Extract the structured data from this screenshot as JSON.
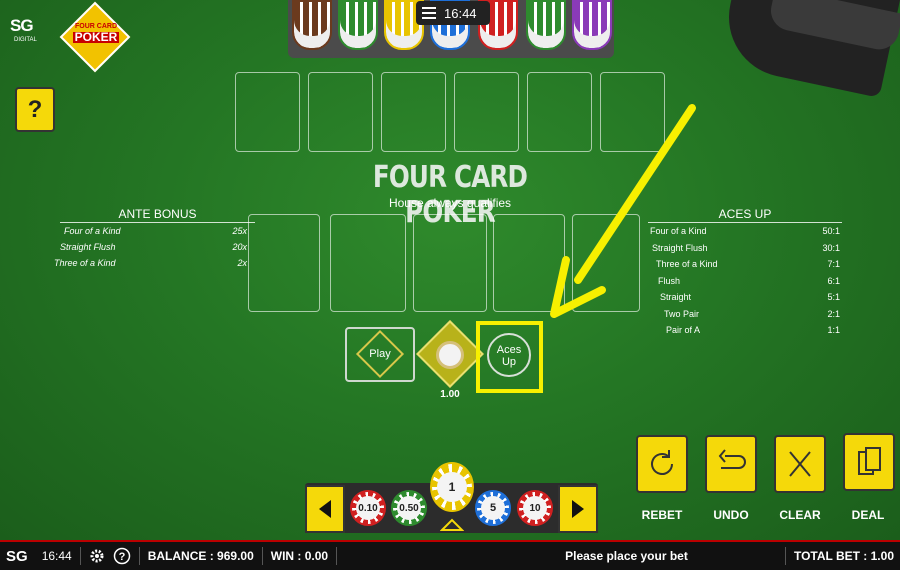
{
  "brand": {
    "sg_logo": "SG",
    "sg_sub": "DIGITAL",
    "game_logo_top": "FOUR CARD",
    "game_logo_bottom": "POKER"
  },
  "help": {
    "label": "?"
  },
  "header": {
    "time": "16:44"
  },
  "rack_chips": [
    "#6b3a1e",
    "#2e8b2e",
    "#e8c400",
    "#1e6fd8",
    "#d02020",
    "#2e8b2e",
    "#8a3ab8"
  ],
  "table": {
    "title": "FOUR CARD POKER",
    "subtitle": "House always qualifies"
  },
  "ante_bonus": {
    "header": "ANTE BONUS",
    "rows": [
      {
        "hand": "Four of a Kind",
        "payout": "25x"
      },
      {
        "hand": "Straight Flush",
        "payout": "20x"
      },
      {
        "hand": "Three of a Kind",
        "payout": "2x"
      }
    ]
  },
  "aces_up": {
    "header": "ACES UP",
    "rows": [
      {
        "hand": "Four of a Kind",
        "payout": "50:1"
      },
      {
        "hand": "Straight Flush",
        "payout": "30:1"
      },
      {
        "hand": "Three of a Kind",
        "payout": "7:1"
      },
      {
        "hand": "Flush",
        "payout": "6:1"
      },
      {
        "hand": "Straight",
        "payout": "5:1"
      },
      {
        "hand": "Two Pair",
        "payout": "2:1"
      },
      {
        "hand": "Pair of A",
        "payout": "1:1"
      }
    ]
  },
  "bets": {
    "play_label": "Play",
    "ante_amount": "1.00",
    "aces_up_label_1": "Aces",
    "aces_up_label_2": "Up"
  },
  "actions": {
    "rebet": "REBET",
    "undo": "UNDO",
    "clear": "CLEAR",
    "deal": "DEAL"
  },
  "chips": {
    "values": [
      "0.10",
      "0.50",
      "1",
      "5",
      "10"
    ],
    "colors": [
      "#d02020",
      "#2e8b2e",
      "#e8c400",
      "#1e6fd8",
      "#d02020"
    ],
    "selected": "1"
  },
  "status_bar": {
    "logo": "SG",
    "time": "16:44",
    "balance": "BALANCE : 969.00",
    "win": "WIN : 0.00",
    "message": "Please place your bet",
    "total_bet": "TOTAL BET : 1.00"
  },
  "accent": {
    "yellow": "#f5d90a",
    "highlight": "#f7f000",
    "felt": "#247624"
  }
}
